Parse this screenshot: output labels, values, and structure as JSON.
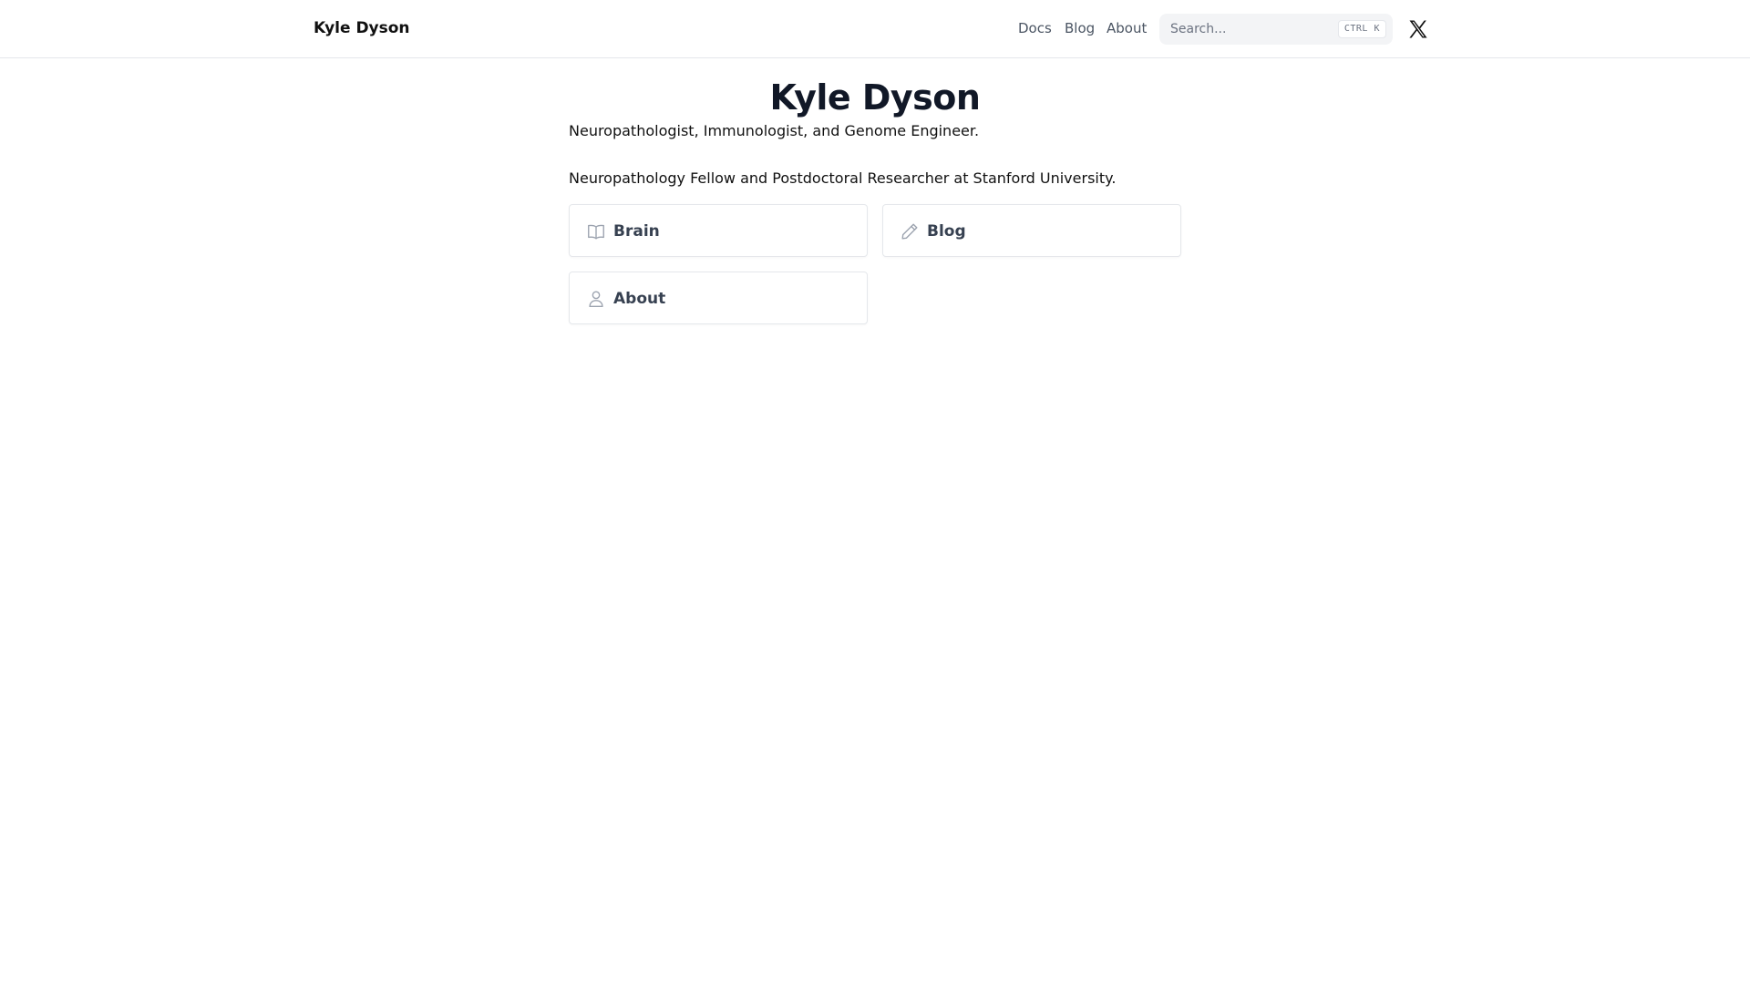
{
  "navbar": {
    "brand": "Kyle Dyson",
    "links": [
      {
        "label": "Docs"
      },
      {
        "label": "Blog"
      },
      {
        "label": "About"
      }
    ],
    "search": {
      "placeholder": "Search...",
      "shortcut": "CTRL K"
    },
    "social_icon": "x-logo-icon"
  },
  "hero": {
    "title": "Kyle Dyson",
    "tagline": "Neuropathologist, Immunologist, and Genome Engineer.",
    "position": "Neuropathology Fellow and Postdoctoral Researcher at Stanford University."
  },
  "cards": [
    {
      "label": "Brain",
      "icon": "book-open-icon"
    },
    {
      "label": "Blog",
      "icon": "pencil-icon"
    },
    {
      "label": "About",
      "icon": "user-icon"
    }
  ],
  "colors": {
    "text_primary": "#111827",
    "nav_text": "#4b5563",
    "card_text": "#374151",
    "border": "#e5e7eb",
    "search_bg": "#f3f4f6",
    "icon_gray": "#9ca3af"
  }
}
